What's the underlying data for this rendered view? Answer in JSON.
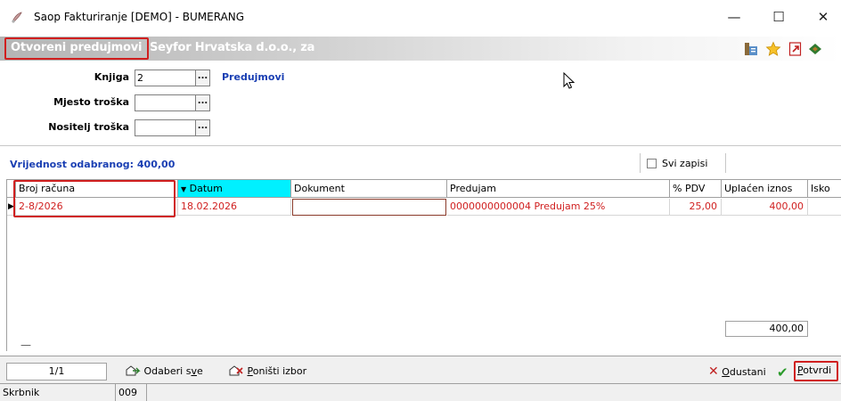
{
  "window": {
    "title": "Saop Fakturiranje [DEMO] - BUMERANG",
    "controls": {
      "minimize": "—",
      "maximize": "☐",
      "close": "✕"
    }
  },
  "header": {
    "title": "Otvoreni predujmovi",
    "subtitle": "Seyfor Hrvatska d.o.o., za",
    "icons": [
      "document-tree-icon",
      "star-icon",
      "export-icon",
      "hat-icon"
    ]
  },
  "filters": {
    "knjiga": {
      "label": "Knjiga",
      "value": "2",
      "name": "Predujmovi"
    },
    "mjesto": {
      "label": "Mjesto troška",
      "value": ""
    },
    "nositelj": {
      "label": "Nositelj troška",
      "value": ""
    },
    "picker_label": "..."
  },
  "summary": {
    "label": "Vrijednost odabranog: 400,00",
    "svi_zapisi": "Svi zapisi",
    "svi_zapisi_checked": false
  },
  "grid": {
    "columns": [
      "Broj računa",
      "Datum",
      "Dokument",
      "Predujam",
      "% PDV",
      "Uplaćen iznos",
      "Isko"
    ],
    "sort_column": "Datum",
    "rows": [
      [
        "2-8/2026",
        "18.02.2026",
        "",
        "0000000000004 Predujam 25%",
        "25,00",
        "400,00",
        ""
      ]
    ],
    "total": "400,00",
    "footer_dash": "—"
  },
  "bottom": {
    "pager": "1/1",
    "select_all": "Odaberi sve",
    "select_all_key": "v",
    "clear": "Poništi izbor",
    "clear_key": "P",
    "cancel": "Odustani",
    "cancel_key": "O",
    "confirm": "Potvrdi",
    "confirm_key": "P"
  },
  "statusbar": {
    "user": "Skrbnik",
    "code": "009"
  },
  "colors": {
    "highlight_red": "#d01f1f",
    "link_blue": "#1a3fb3",
    "sort_header": "#00f0ff"
  }
}
